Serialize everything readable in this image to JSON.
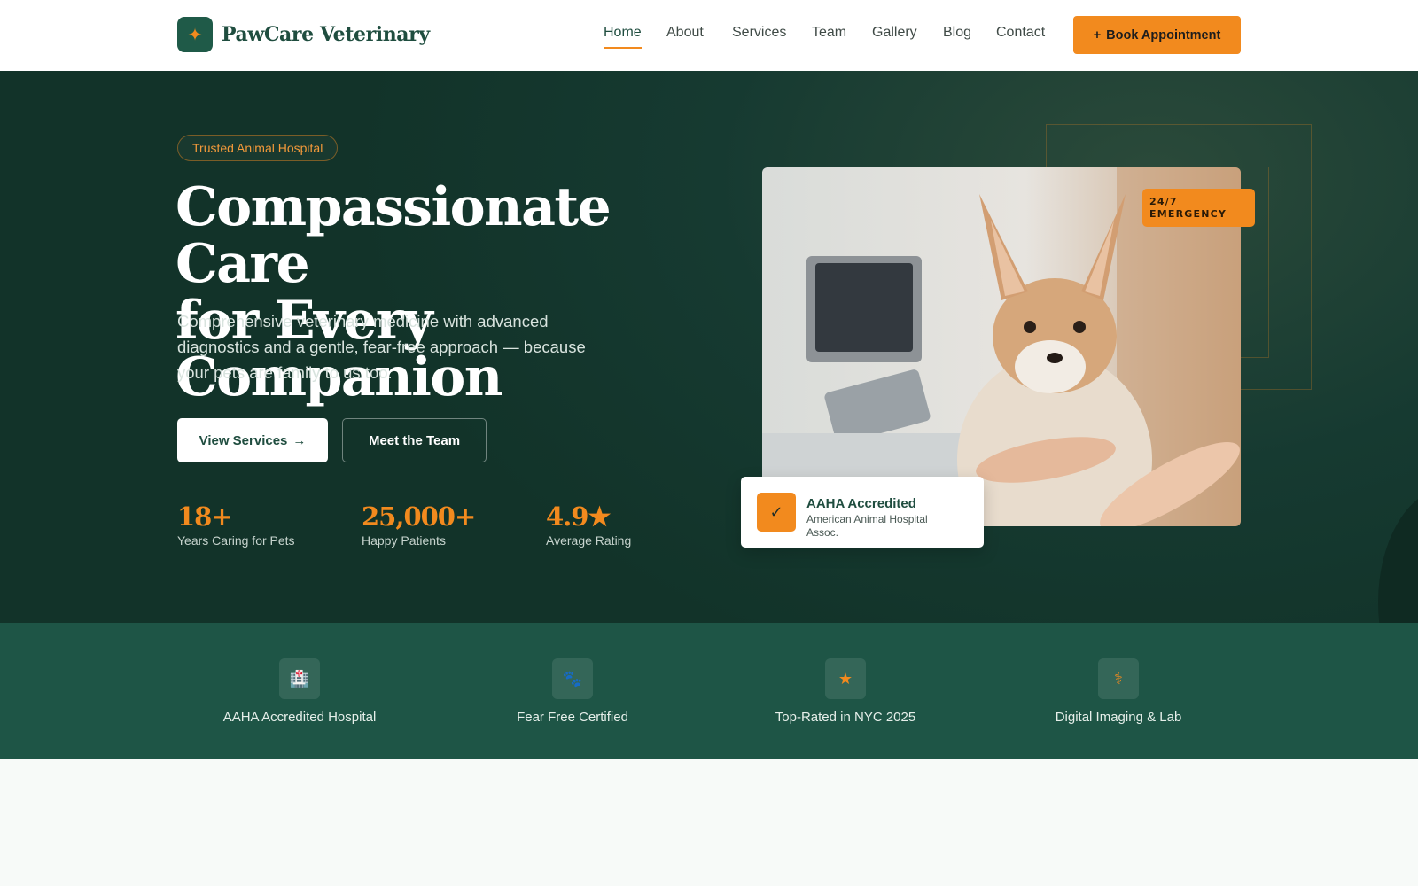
{
  "brand": {
    "name": "PawCare Veterinary",
    "logo_icon": "sparkle-icon",
    "accent": "#f28a1e",
    "primary": "#1f4d3f"
  },
  "nav": {
    "items": [
      {
        "label": "Home",
        "active": true
      },
      {
        "label": "About"
      },
      {
        "label": "Services"
      },
      {
        "label": "Team"
      },
      {
        "label": "Gallery"
      },
      {
        "label": "Blog"
      },
      {
        "label": "Contact"
      }
    ],
    "cta_icon": "+",
    "cta_label": "Book Appointment"
  },
  "hero": {
    "badge": "Trusted Animal Hospital",
    "title_line1": "Compassionate Care",
    "title_line2": "for Every Companion",
    "description": "Comprehensive veterinary medicine with advanced diagnostics and a gentle, fear-free approach — because your pets are family to us too.",
    "primary_button": "View Services",
    "primary_button_arrow": "→",
    "secondary_button": "Meet the Team",
    "stats": [
      {
        "value": "18+",
        "label": "Years Caring for Pets"
      },
      {
        "value": "25,000+",
        "label": "Happy Patients"
      },
      {
        "value": "4.9★",
        "label": "Average Rating"
      }
    ],
    "emergency_line1": "24/7",
    "emergency_line2": "EMERGENCY",
    "accreditation": {
      "icon": "✓",
      "title": "AAHA Accredited",
      "subtitle": "American Animal Hospital Assoc."
    }
  },
  "features": [
    {
      "icon": "🏥",
      "icon_name": "hospital-icon",
      "label": "AAHA Accredited Hospital"
    },
    {
      "icon": "🐾",
      "icon_name": "paw-icon",
      "label": "Fear Free Certified"
    },
    {
      "icon": "★",
      "icon_name": "star-icon",
      "label": "Top-Rated in NYC 2025"
    },
    {
      "icon": "⚕",
      "icon_name": "medical-icon",
      "label": "Digital Imaging & Lab"
    }
  ]
}
